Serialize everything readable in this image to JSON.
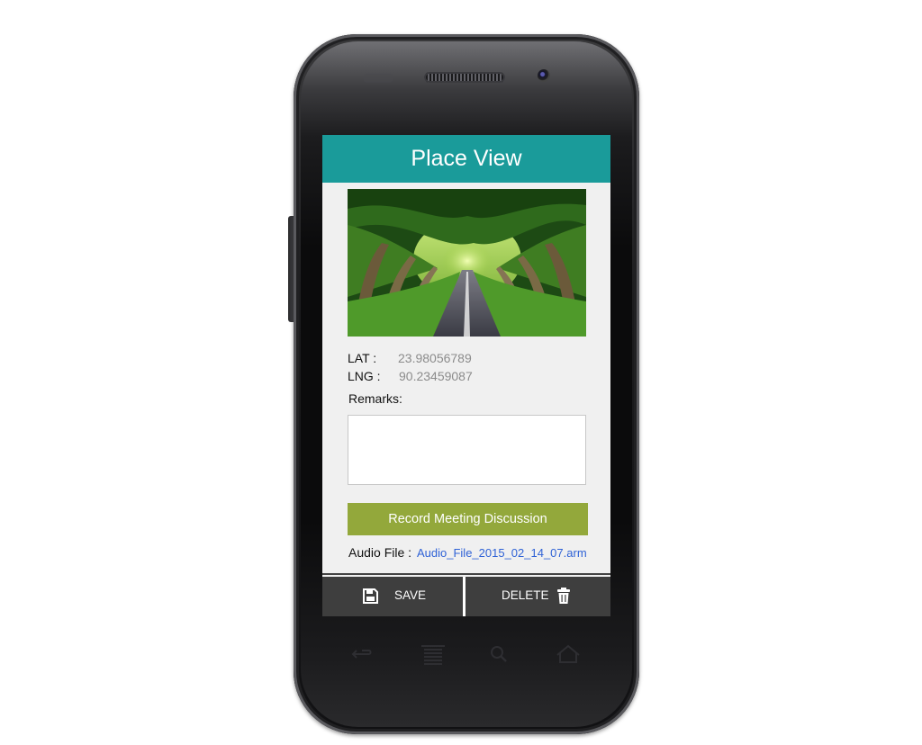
{
  "header": {
    "title": "Place View"
  },
  "coordinates": {
    "lat_label": "LAT :",
    "lat_value": "23.98056789",
    "lng_label": "LNG :",
    "lng_value": "90.23459087"
  },
  "remarks": {
    "label": "Remarks:",
    "value": ""
  },
  "record": {
    "label": "Record Meeting Discussion"
  },
  "audio": {
    "label": "Audio File :",
    "file_name": "Audio_File_2015_02_14_07.arm"
  },
  "actions": {
    "save_label": "SAVE",
    "save_icon": "floppy-disk-icon",
    "delete_label": "DELETE",
    "delete_icon": "trash-icon"
  },
  "hardware_keys": [
    "back-icon",
    "menu-icon",
    "search-icon",
    "home-icon"
  ],
  "colors": {
    "title_bar": "#1a9b9a",
    "record_button": "#93a83b",
    "action_bar": "#3e3e3e",
    "link": "#2f62d6",
    "screen_bg": "#f0f0f0"
  }
}
